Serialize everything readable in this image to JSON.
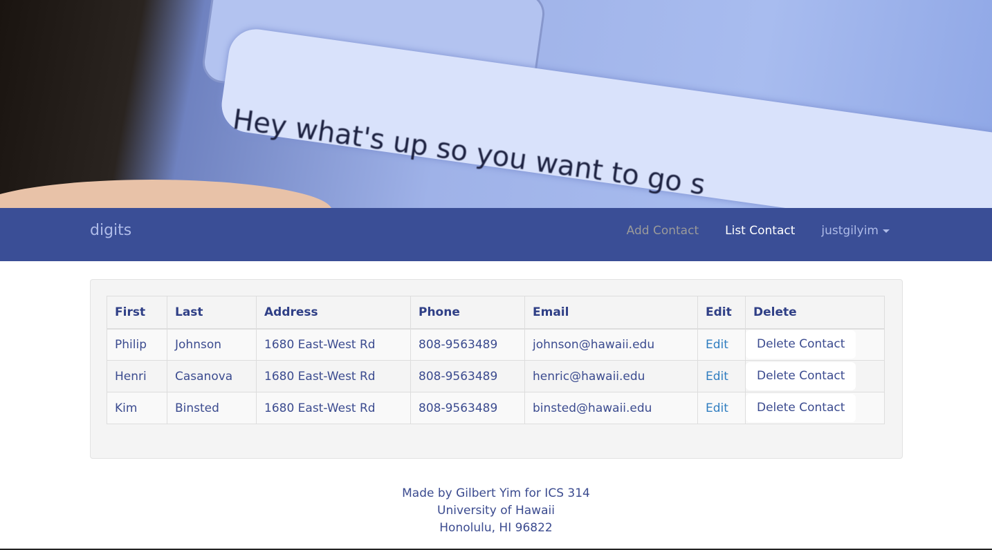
{
  "hero": {
    "photo_text": "Hey what's up so you want to go s"
  },
  "nav": {
    "brand": "digits",
    "add": "Add Contact",
    "list": "List Contact",
    "user": "justgilyim"
  },
  "table": {
    "headers": [
      "First",
      "Last",
      "Address",
      "Phone",
      "Email",
      "Edit",
      "Delete"
    ],
    "rows": [
      {
        "first": "Philip",
        "last": "Johnson",
        "address": "1680 East-West Rd",
        "phone": "808-9563489",
        "email": "johnson@hawaii.edu",
        "edit": "Edit",
        "delete": "Delete Contact"
      },
      {
        "first": "Henri",
        "last": "Casanova",
        "address": "1680 East-West Rd",
        "phone": "808-9563489",
        "email": "henric@hawaii.edu",
        "edit": "Edit",
        "delete": "Delete Contact"
      },
      {
        "first": "Kim",
        "last": "Binsted",
        "address": "1680 East-West Rd",
        "phone": "808-9563489",
        "email": "binsted@hawaii.edu",
        "edit": "Edit",
        "delete": "Delete Contact"
      }
    ]
  },
  "footer": {
    "line1": "Made by Gilbert Yim for ICS 314",
    "line2": "University of Hawaii",
    "line3": "Honolulu, HI 96822"
  }
}
